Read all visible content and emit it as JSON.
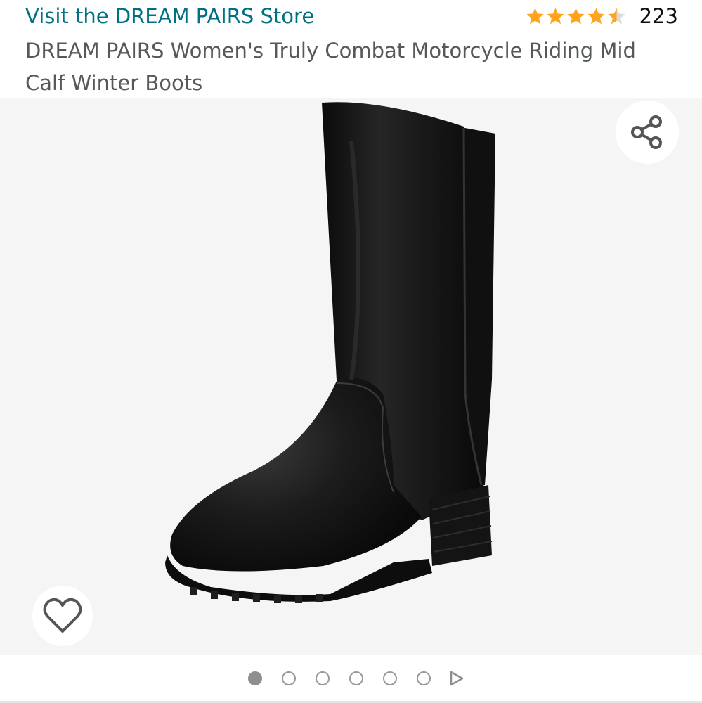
{
  "header": {
    "store_link": "Visit the DREAM PAIRS Store",
    "rating_stars": 4.5,
    "rating_count": "223",
    "star_color": "#FFA41C",
    "title": "DREAM PAIRS Women's Truly Combat Motorcycle Riding Mid Calf Winter Boots"
  },
  "gallery": {
    "image_subject": "black mid calf boot",
    "share_icon": "share-icon",
    "wishlist_icon": "heart-icon",
    "dot_count": 6,
    "active_index": 0,
    "video_icon": "play-icon"
  },
  "colors": {
    "link": "#007185",
    "title": "#565959",
    "image_bg": "#F5F5F5"
  }
}
